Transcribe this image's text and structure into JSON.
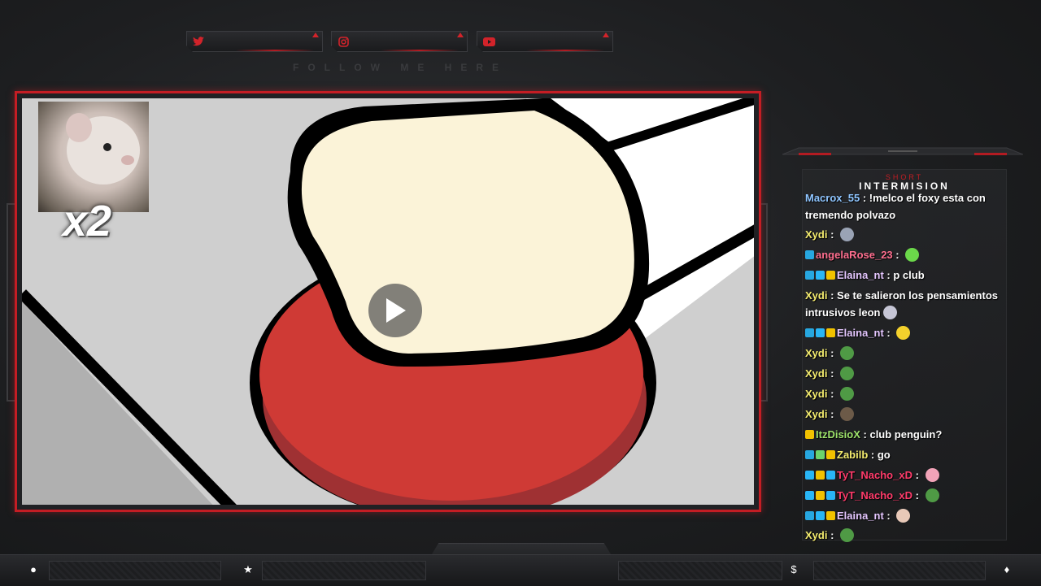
{
  "overlay": {
    "follow_text": "FOLLOW ME HERE",
    "cam_label": "x2",
    "chat_title_small": "SHORT",
    "chat_title": "INTERMISION"
  },
  "social": [
    {
      "platform": "twitter",
      "icon": "twitter-icon"
    },
    {
      "platform": "instagram",
      "icon": "instagram-icon"
    },
    {
      "platform": "youtube",
      "icon": "youtube-icon"
    }
  ],
  "chat": [
    {
      "user": "Macrox_55",
      "color": "#8ec5ff",
      "badges": [],
      "text": "!melco el foxy esta con tremendo polvazo",
      "emote": ""
    },
    {
      "user": "Xydi",
      "color": "#f4ec6e",
      "badges": [],
      "text": "",
      "emote": "face-emote"
    },
    {
      "user": "angelaRose_23",
      "color": "#ff6f8f",
      "badges": [
        "prime"
      ],
      "text": "",
      "emote": "green-blob-emote"
    },
    {
      "user": "Elaina_nt",
      "color": "#e5c7ff",
      "badges": [
        "prime",
        "cube",
        "crown"
      ],
      "text": "p club",
      "emote": ""
    },
    {
      "user": "Xydi",
      "color": "#f4ec6e",
      "badges": [],
      "text": "Se te salieron los pensamientos intrusivos leon",
      "emote": "cat-emote"
    },
    {
      "user": "Elaina_nt",
      "color": "#e5c7ff",
      "badges": [
        "prime",
        "cube",
        "crown"
      ],
      "text": "",
      "emote": "pikachu-emote"
    },
    {
      "user": "Xydi",
      "color": "#f4ec6e",
      "badges": [],
      "text": "",
      "emote": "pepe-emote"
    },
    {
      "user": "Xydi",
      "color": "#f4ec6e",
      "badges": [],
      "text": "",
      "emote": "pepe-emote"
    },
    {
      "user": "Xydi",
      "color": "#f4ec6e",
      "badges": [],
      "text": "",
      "emote": "pepe-emote"
    },
    {
      "user": "Xydi",
      "color": "#f4ec6e",
      "badges": [],
      "text": "",
      "emote": "dog-emote"
    },
    {
      "user": "ItzDisioX",
      "color": "#9ee36b",
      "badges": [
        "gold"
      ],
      "text": "club penguin?",
      "emote": ""
    },
    {
      "user": "Zabilb",
      "color": "#f4ec6e",
      "badges": [
        "prime",
        "leaf",
        "gold"
      ],
      "text": "go",
      "emote": ""
    },
    {
      "user": "TyT_Nacho_xD",
      "color": "#ff3b6a",
      "badges": [
        "cube",
        "shield",
        "cube2"
      ],
      "text": "",
      "emote": "kirby-emote"
    },
    {
      "user": "TyT_Nacho_xD",
      "color": "#ff3b6a",
      "badges": [
        "cube",
        "shield",
        "cube2"
      ],
      "text": "",
      "emote": "pepe-emote"
    },
    {
      "user": "Elaina_nt",
      "color": "#e5c7ff",
      "badges": [
        "prime",
        "cube",
        "crown"
      ],
      "text": "",
      "emote": "face2-emote"
    },
    {
      "user": "Xydi",
      "color": "#f4ec6e",
      "badges": [],
      "text": "",
      "emote": "pepe-emote"
    }
  ],
  "bottom_icons": [
    {
      "name": "user-icon",
      "glyph": "●"
    },
    {
      "name": "star-icon",
      "glyph": "★"
    },
    {
      "name": "dollar-icon",
      "glyph": "$"
    },
    {
      "name": "drop-icon",
      "glyph": "♦"
    }
  ]
}
